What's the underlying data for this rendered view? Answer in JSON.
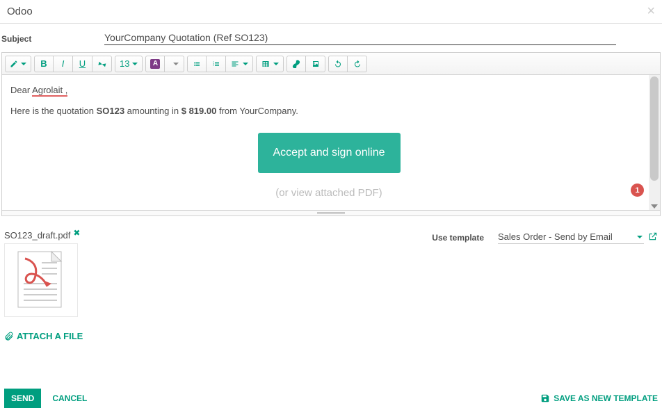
{
  "header": {
    "title": "Odoo"
  },
  "subject": {
    "label": "Subject",
    "value": "YourCompany Quotation (Ref SO123)"
  },
  "toolbar": {
    "font_size": "13",
    "color_swatch_letter": "A"
  },
  "body": {
    "greeting_pre": "Dear ",
    "greeting_name": "Agrolait ,",
    "line2_pre": "Here is the quotation ",
    "so_ref": "SO123",
    "line2_mid": " amounting in ",
    "amount": "$ 819.00",
    "line2_post": " from YourCompany.",
    "accept_button": "Accept and sign online",
    "or_view": "(or view attached PDF)"
  },
  "badge": {
    "count": "1"
  },
  "attachment": {
    "filename": "SO123_draft.pdf",
    "attach_label": "ATTACH A FILE"
  },
  "template": {
    "label": "Use template",
    "selected": "Sales Order - Send by Email"
  },
  "footer": {
    "send": "SEND",
    "cancel": "CANCEL",
    "save_template": "SAVE AS NEW TEMPLATE"
  }
}
